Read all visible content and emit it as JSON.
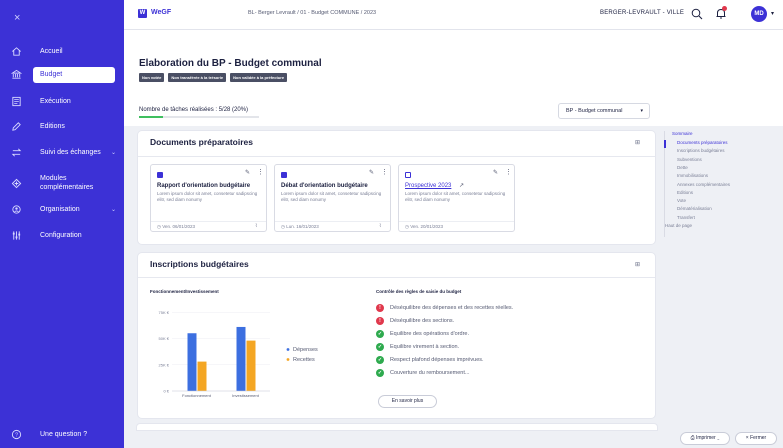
{
  "sidebar": {
    "close_icon": "×",
    "items": [
      {
        "label": "Accueil",
        "icon": "home-icon"
      },
      {
        "label": "Budget",
        "icon": "bank-icon"
      },
      {
        "label": "Exécution",
        "icon": "sheet-icon"
      },
      {
        "label": "Editions",
        "icon": "pencil-icon"
      },
      {
        "label": "Suivi des échanges",
        "icon": "exchange-icon"
      },
      {
        "label": "Modules complémentaires",
        "icon": "puzzle-icon"
      },
      {
        "label": "Organisation",
        "icon": "org-icon"
      },
      {
        "label": "Configuration",
        "icon": "sliders-icon"
      }
    ],
    "footer_label": "Une question ?",
    "accent": "#3c31d6"
  },
  "topbar": {
    "logo_mark": "W",
    "logo_text": "WeGF",
    "breadcrumb": "BL- Berger Levrault / 01 - Budget COMMUNE / 2023",
    "organization": "BERGER-LEVRAULT - VILLE",
    "avatar_initials": "MD"
  },
  "header": {
    "title": "Elaboration du BP - Budget communal",
    "badges": [
      "Non votée",
      "Non transférée à la trésorie",
      "Non validée à la préfecture"
    ],
    "tasks_label": "Nombre de tâches réalisées : 5/28 (20%)",
    "tasks_progress": 0.2,
    "select_value": "BP - Budget communal"
  },
  "documents": {
    "title": "Documents préparatoires",
    "cards": [
      {
        "title": "Rapport d'orientation budgétaire",
        "desc": "Lorem ipsum dolor sit amet, consetetur sadipscing elitr, sed diam nonumy",
        "date": "Ven. 06/01/2023",
        "checked": true
      },
      {
        "title": "Débat d'orientation budgétaire",
        "desc": "Lorem ipsum dolor sit amet, consetetur sadipscing elitr, sed diam nonumy",
        "date": "Lun. 16/01/2023",
        "checked": true
      },
      {
        "title": "Prospective 2023",
        "desc": "Lorem ipsum dolor sit amet, consetetur sadipscing elitr, sed diam nonumy",
        "date": "Ven. 20/01/2023",
        "checked": false
      }
    ]
  },
  "inscriptions": {
    "title": "Inscriptions budgétaires",
    "chart_title": "Fonctionnement/Investissement",
    "rules_title": "Contrôle des règles de saisie du budget",
    "rules": [
      {
        "text": "Déséquilibre des dépenses et des recettes réelles.",
        "status": "error"
      },
      {
        "text": "Déséquilibre des sections.",
        "status": "error"
      },
      {
        "text": "Equilibre des opérations d'ordre.",
        "status": "ok"
      },
      {
        "text": "Equilibre virement à section.",
        "status": "ok"
      },
      {
        "text": "Respect plafond dépenses imprévues.",
        "status": "ok"
      },
      {
        "text": "Couverture du remboursement...",
        "status": "ok"
      }
    ],
    "more_label": "En savoir plus"
  },
  "chart_data": {
    "type": "bar",
    "title": "Fonctionnement/Investissement",
    "categories": [
      "Fonctionnement",
      "Investissement"
    ],
    "y_ticks": [
      "0 €",
      "25K €",
      "50K €",
      "75K €"
    ],
    "ylim": [
      0,
      80000
    ],
    "series": [
      {
        "name": "Dépenses",
        "values": [
          55000,
          61000
        ],
        "color": "#3c6fe0"
      },
      {
        "name": "Recettes",
        "values": [
          28000,
          48000
        ],
        "color": "#f4a623"
      }
    ],
    "legend_position": "right"
  },
  "summary": {
    "heading": "Sommaire",
    "items": [
      "Documents préparatoires",
      "Inscriptions budgétaires",
      "Subventions",
      "Dette",
      "Immobilisations",
      "Annexes complémentaires",
      "Editions",
      "Vote",
      "Dématérialisation",
      "Transfert",
      "Haut de page"
    ],
    "current_index": 0
  },
  "footer": {
    "print_label": "Imprimer",
    "close_label": "Fermer"
  }
}
